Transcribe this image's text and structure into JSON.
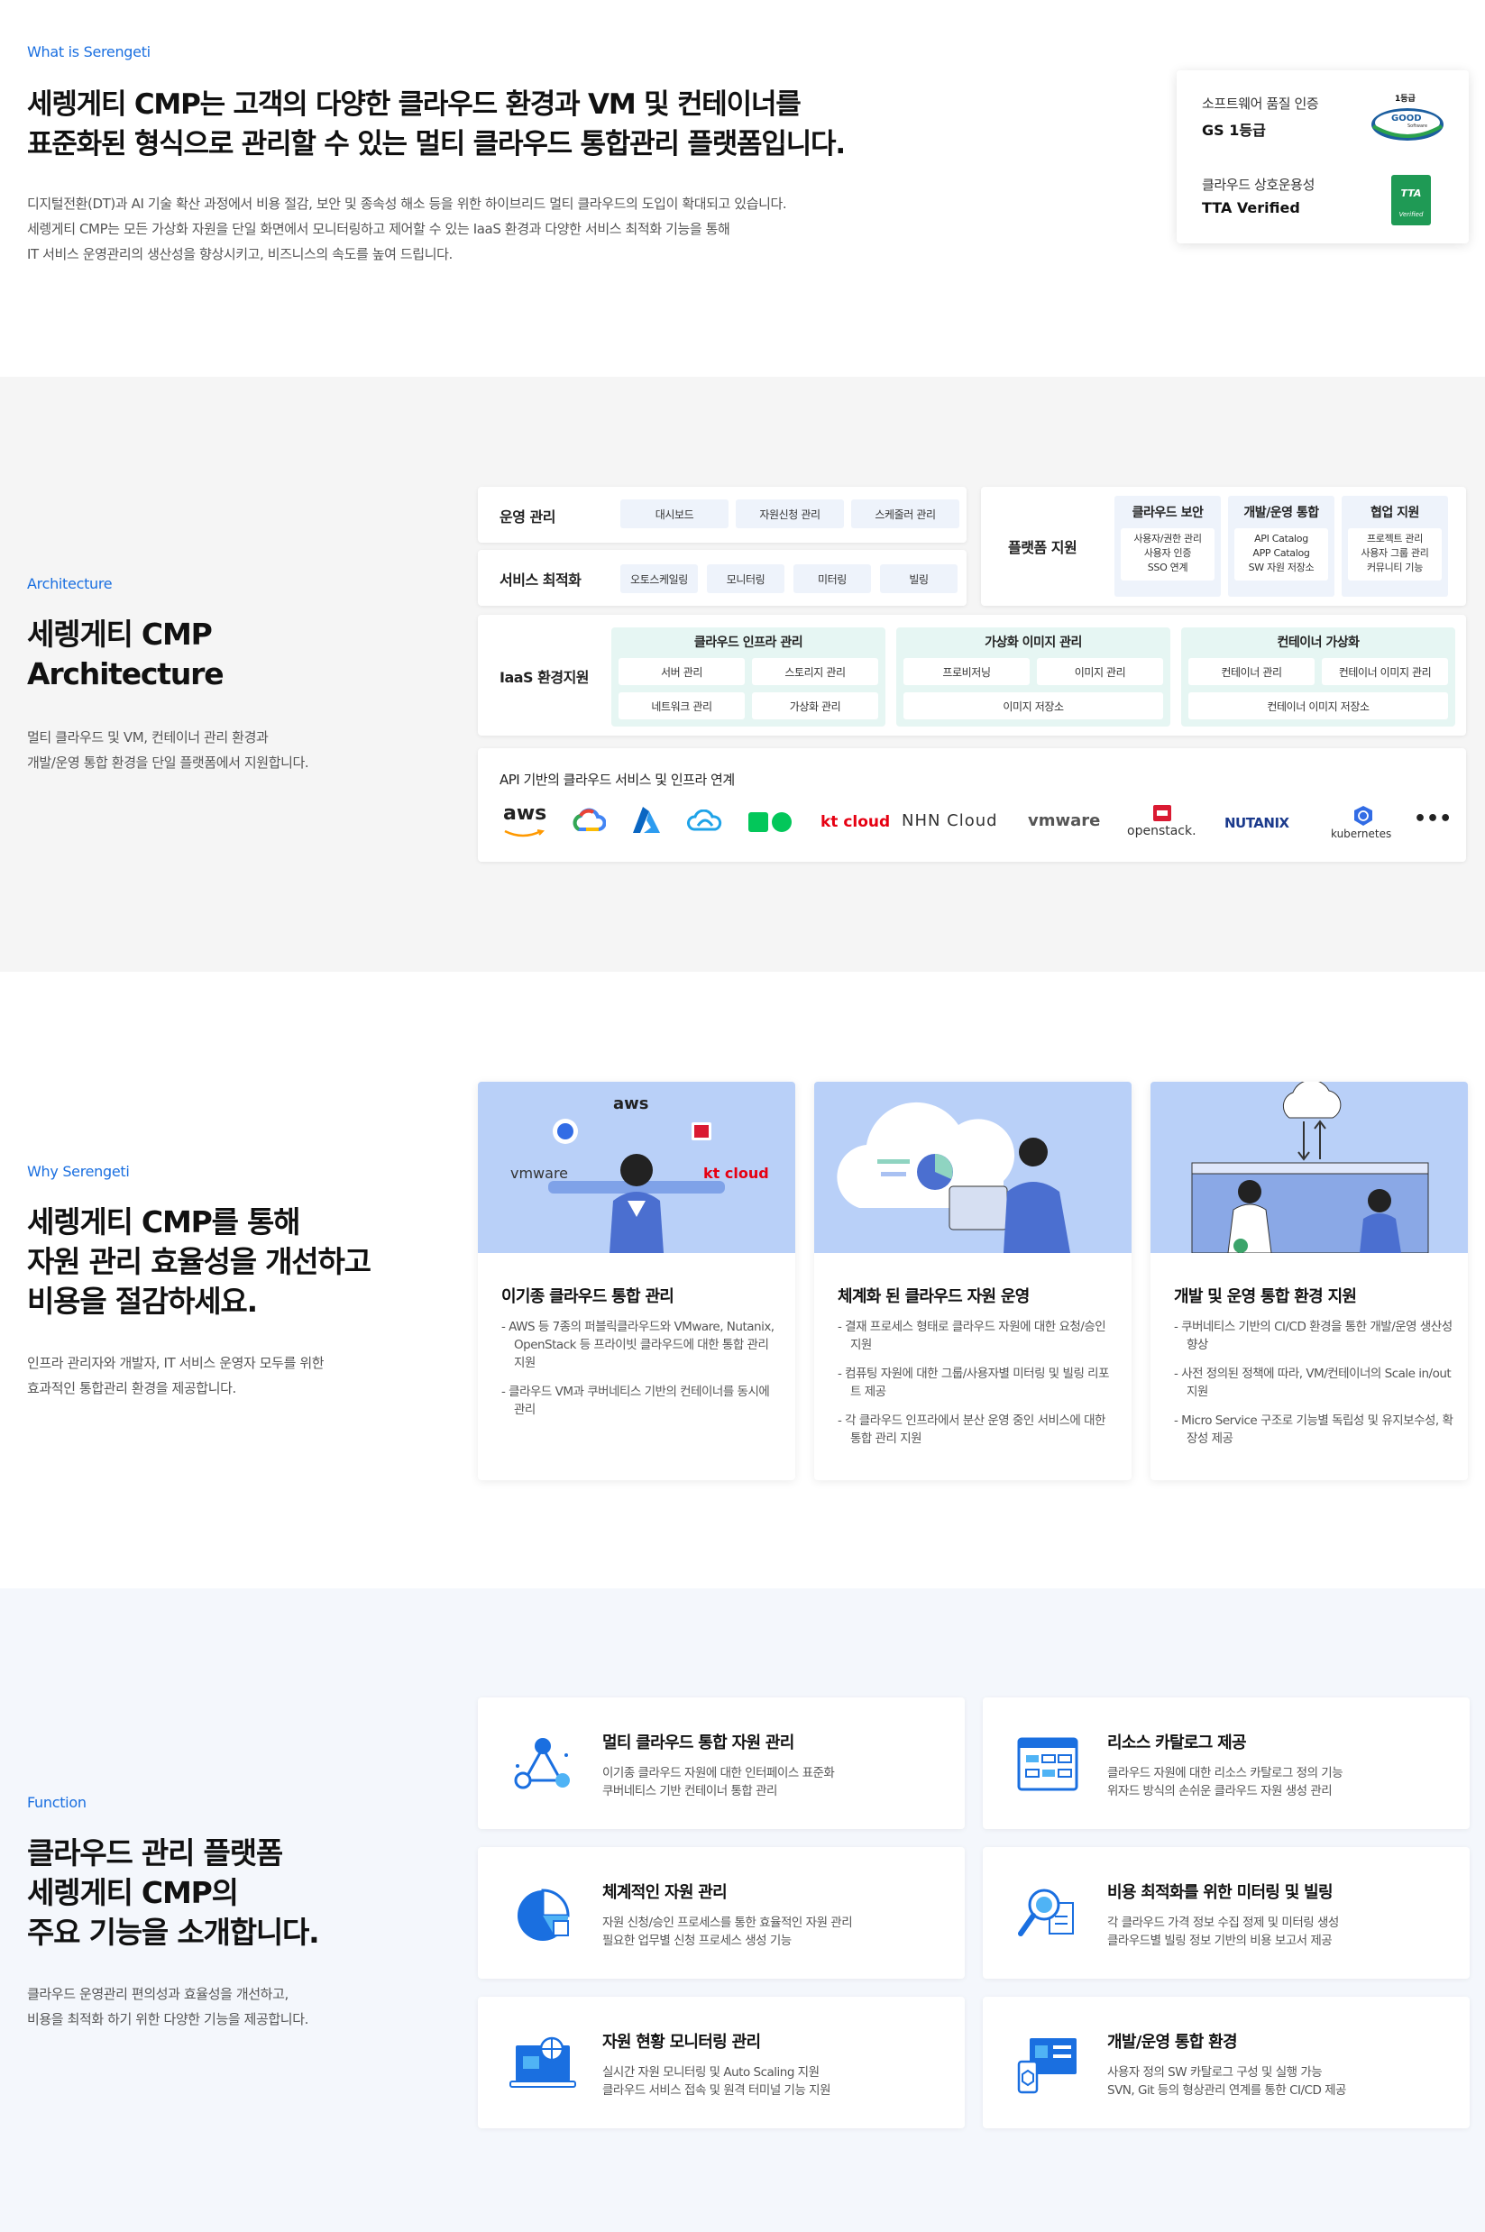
{
  "intro": {
    "eyebrow": "What is Serengeti",
    "title_line1": "세렝게티 CMP는 고객의 다양한 클라우드 환경과 VM 및 컨테이너를",
    "title_line2": "표준화된 형식으로 관리할 수 있는 멀티 클라우드 통합관리 플랫폼입니다.",
    "desc_line1": "디지털전환(DT)과 AI 기술 확산 과정에서 비용 절감, 보안 및 종속성 해소 등을 위한 하이브리드 멀티 클라우드의 도입이 확대되고 있습니다.",
    "desc_line2": "세렝게티 CMP는 모든 가상화 자원을 단일 화면에서 모니터링하고 제어할 수 있는 IaaS 환경과 다양한 서비스 최적화 기능을 통해",
    "desc_line3": "IT 서비스 운영관리의 생산성을 향상시키고, 비즈니스의 속도를 높여 드립니다.",
    "badges": [
      {
        "label": "소프트웨어 품질 인증",
        "value": "GS 1등급",
        "mark": "1등급",
        "mark2": "GOOD",
        "mark3": "Software"
      },
      {
        "label": "클라우드 상호운용성",
        "value": "TTA Verified",
        "mark": "TTA",
        "mark2": "Verified"
      }
    ]
  },
  "architecture": {
    "eyebrow": "Architecture",
    "title_line1": "세렝게티 CMP",
    "title_line2": "Architecture",
    "desc_line1": "멀티 클라우드 및 VM, 컨테이너 관리 환경과",
    "desc_line2": "개발/운영 통합 환경을 단일 플랫폼에서 지원합니다.",
    "ops": {
      "label": "운영 관리",
      "items": [
        "대시보드",
        "자원신청 관리",
        "스케줄러 관리"
      ]
    },
    "svc": {
      "label": "서비스 최적화",
      "items": [
        "오토스케일링",
        "모니터링",
        "미터링",
        "빌링"
      ]
    },
    "platform": {
      "label": "플랫폼 지원",
      "groups": [
        {
          "title": "클라우드 보안",
          "l1": "사용자/권한 관리",
          "l2": "사용자 인증",
          "l3": "SSO 연계"
        },
        {
          "title": "개발/운영 통합",
          "l1": "API Catalog",
          "l2": "APP Catalog",
          "l3": "SW 자원 저장소"
        },
        {
          "title": "협업 지원",
          "l1": "프로젝트 관리",
          "l2": "사용자 그룹 관리",
          "l3": "커뮤니티 기능"
        }
      ]
    },
    "iaas": {
      "label": "IaaS 환경지원",
      "infra": {
        "title": "클라우드 인프라 관리",
        "items": [
          "서버 관리",
          "스토리지 관리",
          "네트워크 관리",
          "가상화 관리"
        ]
      },
      "image": {
        "title": "가상화 이미지 관리",
        "items": [
          "프로비저닝",
          "이미지 관리",
          "이미지 저장소"
        ]
      },
      "container": {
        "title": "컨테이너 가상화",
        "items": [
          "컨테이너 관리",
          "컨테이너 이미지 관리",
          "컨테이너 이미지 저장소"
        ]
      }
    },
    "api": {
      "label": "API 기반의 클라우드 서비스 및 인프라 연계",
      "logos": [
        "aws",
        "kt cloud",
        "NHN Cloud",
        "vmware",
        "openstack.",
        "NUTANIX",
        "kubernetes"
      ]
    }
  },
  "why": {
    "eyebrow": "Why Serengeti",
    "title_line1": "세렝게티 CMP를 통해",
    "title_line2": "자원 관리 효율성을 개선하고",
    "title_line3": "비용을 절감하세요.",
    "desc_line1": "인프라 관리자와 개발자, IT 서비스 운영자 모두를 위한",
    "desc_line2": "효과적인 통합관리 환경을 제공합니다.",
    "cards": [
      {
        "title": "이기종 클라우드 통합 관리",
        "items": [
          "- AWS 등 7종의 퍼블릭클라우드와 VMware, Nutanix, OpenStack 등 프라이빗 클라우드에 대한 통합 관리 지원",
          "- 클라우드 VM과 쿠버네티스 기반의 컨테이너를 동시에 관리"
        ],
        "img_logos": [
          "aws",
          "vmware",
          "kt cloud"
        ]
      },
      {
        "title": "체계화 된 클라우드 자원 운영",
        "items": [
          "- 결재 프로세스 형태로 클라우드 자원에 대한 요청/승인 지원",
          "- 컴퓨팅 자원에 대한 그룹/사용자별 미터링 및 빌링 리포트 제공",
          "- 각 클라우드 인프라에서 분산 운영 중인 서비스에 대한 통합 관리 지원"
        ]
      },
      {
        "title": "개발 및 운영 통합 환경 지원",
        "items": [
          "- 쿠버네티스 기반의 CI/CD 환경을 통한 개발/운영 생산성 향상",
          "- 사전 정의된 정책에 따라, VM/컨테이너의 Scale in/out 지원",
          "- Micro Service 구조로 기능별 독립성 및 유지보수성, 확장성 제공"
        ]
      }
    ]
  },
  "function": {
    "eyebrow": "Function",
    "title_line1": "클라우드 관리 플랫폼",
    "title_line2": "세렝게티 CMP의",
    "title_line3": "주요 기능을 소개합니다.",
    "desc_line1": "클라우드 운영관리 편의성과 효율성을 개선하고,",
    "desc_line2": "비용을 최적화 하기 위한 다양한 기능을 제공합니다.",
    "cards": [
      {
        "title": "멀티 클라우드 통합 자원 관리",
        "l1": "이기종 클라우드 자원에 대한 인터페이스 표준화",
        "l2": "쿠버네티스 기반 컨테이너 통합 관리",
        "icon": "network-icon"
      },
      {
        "title": "리소스 카탈로그 제공",
        "l1": "클라우드 자원에 대한 리소스 카탈로그 정의 기능",
        "l2": "위자드 방식의 손쉬운 클라우드 자원 생성 관리",
        "icon": "catalog-icon"
      },
      {
        "title": "체계적인 자원 관리",
        "l1": "자원 신청/승인 프로세스를 통한 효율적인 자원 관리",
        "l2": "필요한 업무별 신청 프로세스 생성 기능",
        "icon": "pie-chart-icon"
      },
      {
        "title": "비용 최적화를 위한 미터링 및 빌링",
        "l1": "각 클라우드 가격 정보 수집 정제 및 미터링 생성",
        "l2": "클라우드별 빌링 정보 기반의 비용 보고서 제공",
        "icon": "billing-search-icon"
      },
      {
        "title": "자원 현황 모니터링 관리",
        "l1": "실시간 자원 모니터링 및 Auto Scaling 지원",
        "l2": "클라우드 서비스 접속 및 원격 터미널 기능 지원",
        "icon": "monitor-globe-icon"
      },
      {
        "title": "개발/운영 통합 환경",
        "l1": "사용자 정의 SW 카탈로그 구성 및 실행 가능",
        "l2": "SVN, Git 등의 형상관리 연계를 통한 CI/CD 제공",
        "icon": "devops-icon"
      }
    ]
  },
  "colors": {
    "accent": "#1a6fe0",
    "mint": "#e6f6f3",
    "pale_blue": "#eef3fb",
    "illustration_bg": "#b9d0f8"
  }
}
